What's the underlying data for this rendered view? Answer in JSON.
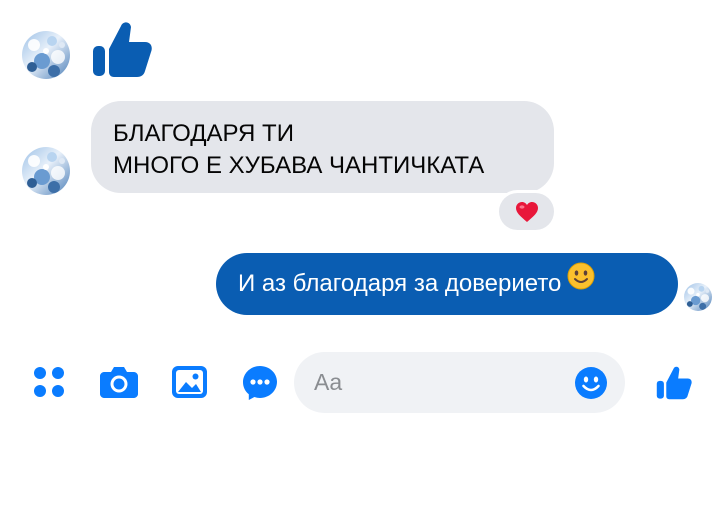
{
  "conversation": {
    "messages": [
      {
        "direction": "incoming",
        "type": "like-sticker",
        "icon": "thumbs-up-icon"
      },
      {
        "direction": "incoming",
        "type": "text",
        "lines": [
          "БЛАГОДАРЯ ТИ",
          "МНОГО Е ХУБАВА ЧАНТИЧКАТА"
        ],
        "reaction": "heart-icon"
      },
      {
        "direction": "outgoing",
        "type": "text",
        "text": "И аз благодаря за доверието",
        "emoji": "slightly-smiling-face-icon",
        "seen_indicator": "avatar"
      }
    ]
  },
  "composer": {
    "actions": [
      {
        "icon": "apps-grid-icon"
      },
      {
        "icon": "camera-icon"
      },
      {
        "icon": "gallery-icon"
      },
      {
        "icon": "chat-more-icon"
      }
    ],
    "placeholder": "Aa",
    "value": "",
    "emoji_icon": "smiley-icon",
    "send_icon": "thumbs-up-icon"
  },
  "colors": {
    "brand_blue": "#0a5db2",
    "accent_blue": "#0a7cff",
    "incoming_bubble": "#e4e6eb",
    "composer_bg": "#f0f2f5",
    "heart_red": "#e8173a",
    "smiley_yellow": "#fbc02d"
  }
}
